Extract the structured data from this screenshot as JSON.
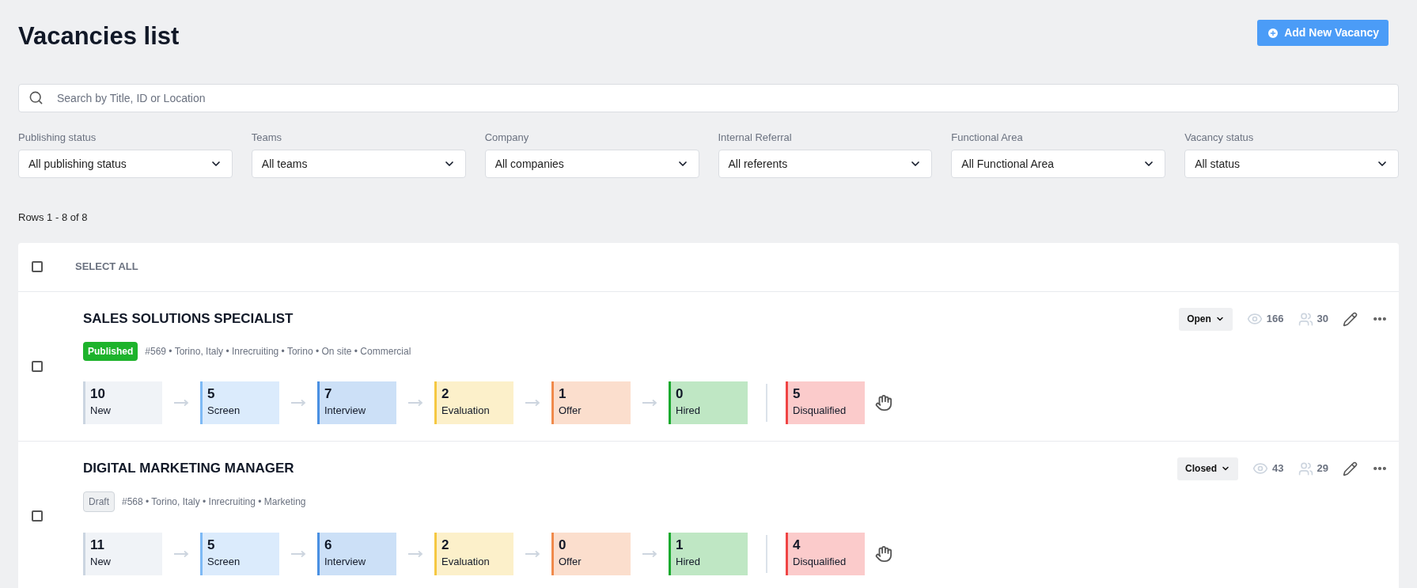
{
  "title": "Vacancies list",
  "add_button": "Add New Vacancy",
  "search": {
    "placeholder": "Search by Title, ID or Location"
  },
  "filters": [
    {
      "label": "Publishing status",
      "value": "All publishing status"
    },
    {
      "label": "Teams",
      "value": "All teams"
    },
    {
      "label": "Company",
      "value": "All companies"
    },
    {
      "label": "Internal Referral",
      "value": "All referents"
    },
    {
      "label": "Functional Area",
      "value": "All Functional Area"
    },
    {
      "label": "Vacancy status",
      "value": "All status"
    }
  ],
  "rows_info": "Rows 1 - 8 of 8",
  "select_all": {
    "label": "SELECT ALL",
    "checked": false
  },
  "vacancies": [
    {
      "title": "SALES SOLUTIONS SPECIALIST",
      "checked": false,
      "publishing": {
        "kind": "published",
        "label": "Published"
      },
      "meta": "#569 • Torino, Italy • Inrecruiting • Torino • On site • Commercial",
      "status": "Open",
      "views": "166",
      "candidates": "30",
      "stages": [
        {
          "kind": "step",
          "count": "10",
          "label": "New",
          "color": "#cbd5e1"
        },
        {
          "kind": "step",
          "count": "5",
          "label": "Screen",
          "color": "#7db9f5"
        },
        {
          "kind": "step",
          "count": "7",
          "label": "Interview",
          "color": "#4a90e2"
        },
        {
          "kind": "step",
          "count": "2",
          "label": "Evaluation",
          "color": "#f5c842"
        },
        {
          "kind": "step",
          "count": "1",
          "label": "Offer",
          "color": "#f08a4b"
        },
        {
          "kind": "step",
          "count": "0",
          "label": "Hired",
          "color": "#1aaa2e"
        },
        {
          "kind": "rejected",
          "count": "5",
          "label": "Disqualified",
          "color": "#ef4444"
        }
      ]
    },
    {
      "title": "DIGITAL MARKETING MANAGER",
      "checked": false,
      "publishing": {
        "kind": "draft",
        "label": "Draft"
      },
      "meta": "#568 • Torino, Italy • Inrecruiting • Marketing",
      "status": "Closed",
      "views": "43",
      "candidates": "29",
      "stages": [
        {
          "kind": "step",
          "count": "11",
          "label": "New",
          "color": "#cbd5e1"
        },
        {
          "kind": "step",
          "count": "5",
          "label": "Screen",
          "color": "#7db9f5"
        },
        {
          "kind": "step",
          "count": "6",
          "label": "Interview",
          "color": "#4a90e2"
        },
        {
          "kind": "step",
          "count": "2",
          "label": "Evaluation",
          "color": "#f5c842"
        },
        {
          "kind": "step",
          "count": "0",
          "label": "Offer",
          "color": "#f08a4b"
        },
        {
          "kind": "step",
          "count": "1",
          "label": "Hired",
          "color": "#1aaa2e"
        },
        {
          "kind": "rejected",
          "count": "4",
          "label": "Disqualified",
          "color": "#ef4444"
        }
      ]
    }
  ]
}
